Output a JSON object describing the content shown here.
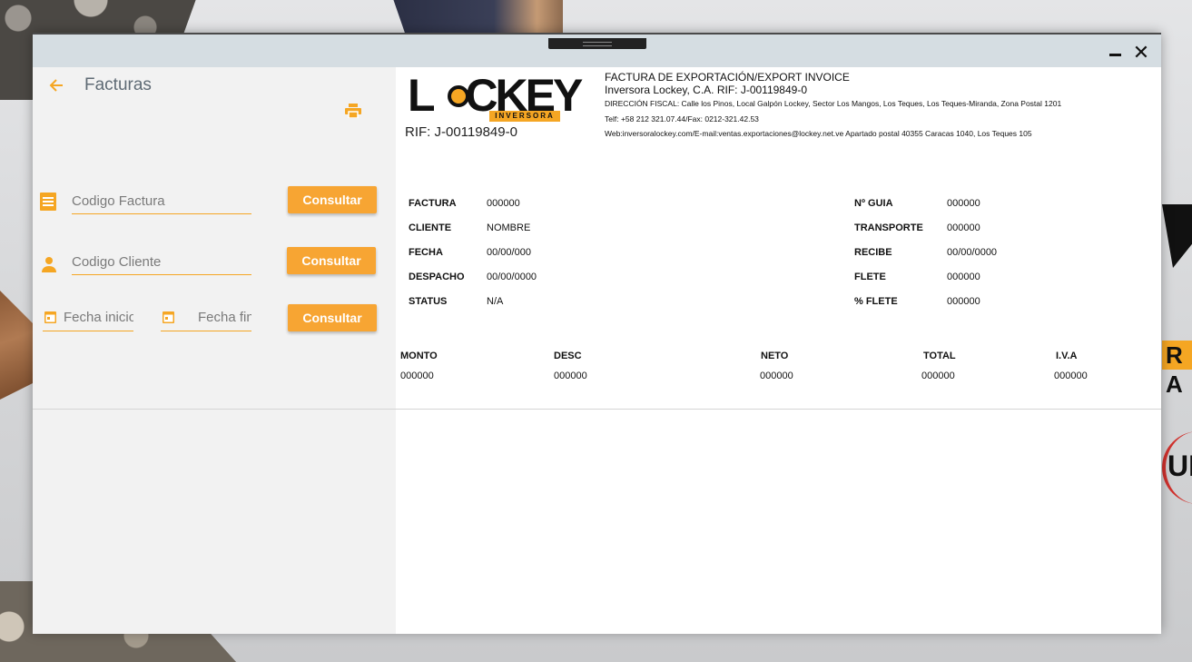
{
  "window": {
    "title": "Facturas"
  },
  "search": {
    "invoice_placeholder": "Codigo Factura",
    "client_placeholder": "Codigo Cliente",
    "date_start_placeholder": "Fecha inicio",
    "date_end_placeholder": "Fecha fin",
    "consult_label": "Consultar"
  },
  "invoice": {
    "logo_text": "LOCKEY",
    "logo_sub": "INVERSORA",
    "rif": "RIF: J-00119849-0",
    "company": {
      "line1": "FACTURA DE EXPORTACIÓN/EXPORT INVOICE",
      "line2": "Inversora Lockey, C.A. RIF: J-00119849-0",
      "address": "DIRECCIÓN FISCAL: Calle los Pinos, Local Galpón Lockey, Sector Los Mangos, Los Teques, Los Teques-Miranda, Zona Postal 1201",
      "phone": "Telf: +58 212 321.07.44/Fax: 0212-321.42.53",
      "web": "Web:inversoralockey.com/E-mail:ventas.exportaciones@lockey.net.ve Apartado postal 40355 Caracas 1040, Los Teques 105"
    },
    "left_fields": [
      {
        "label": "FACTURA",
        "value": "000000"
      },
      {
        "label": "CLIENTE",
        "value": "NOMBRE"
      },
      {
        "label": "FECHA",
        "value": "00/00/000"
      },
      {
        "label": "DESPACHO",
        "value": "00/00/0000"
      },
      {
        "label": "STATUS",
        "value": "N/A"
      }
    ],
    "right_fields": [
      {
        "label": "Nº GUIA",
        "value": "000000"
      },
      {
        "label": "TRANSPORTE",
        "value": "000000"
      },
      {
        "label": "RECIBE",
        "value": "00/00/0000"
      },
      {
        "label": "FLETE",
        "value": "000000"
      },
      {
        "label": "% FLETE",
        "value": "000000"
      }
    ],
    "totals": [
      {
        "label": "MONTO",
        "value": "000000"
      },
      {
        "label": "DESC",
        "value": "000000"
      },
      {
        "label": "NETO",
        "value": "000000"
      },
      {
        "label": "TOTAL",
        "value": "000000"
      },
      {
        "label": "I.V.A",
        "value": "000000"
      }
    ]
  },
  "colors": {
    "accent": "#f7a533",
    "titlebar": "#d5dde2",
    "panel": "#f2f2f2"
  },
  "icons": {
    "back": "arrow-left-icon",
    "print": "printer-icon",
    "invoice": "document-icon",
    "client": "person-icon",
    "calendar": "calendar-icon",
    "minimize": "minimize-icon",
    "close": "close-icon"
  }
}
